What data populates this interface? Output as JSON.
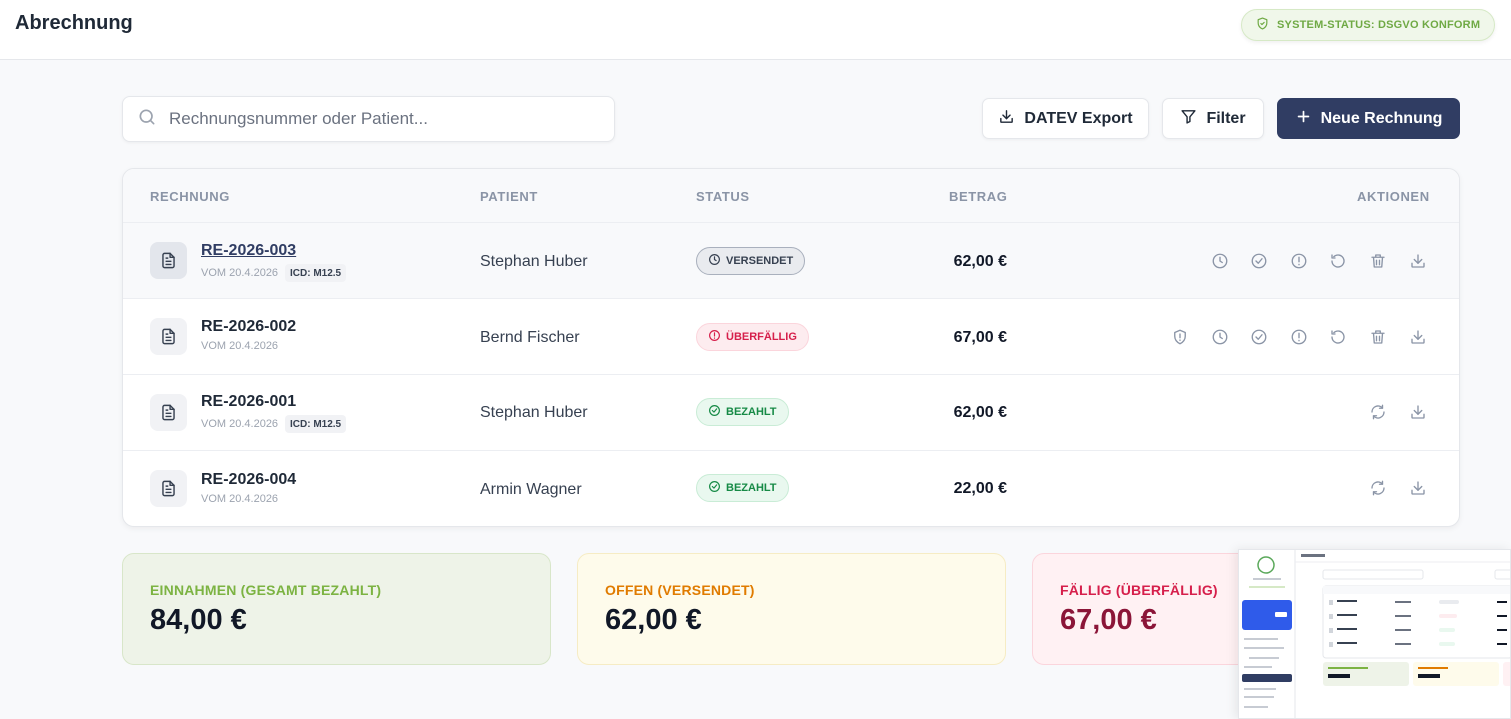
{
  "header": {
    "title": "Abrechnung",
    "system_status": "SYSTEM-STATUS: DSGVO KONFORM"
  },
  "search": {
    "placeholder": "Rechnungsnummer oder Patient..."
  },
  "toolbar": {
    "datev_label": "DATEV Export",
    "filter_label": "Filter",
    "new_label": "Neue Rechnung"
  },
  "table": {
    "columns": [
      "RECHNUNG",
      "PATIENT",
      "STATUS",
      "BETRAG",
      "AKTIONEN"
    ],
    "rows": [
      {
        "number": "RE-2026-003",
        "date": "VOM 20.4.2026",
        "icd": "ICD: M12.5",
        "patient": "Stephan Huber",
        "status": "VERSENDET",
        "amount": "62,00 €"
      },
      {
        "number": "RE-2026-002",
        "date": "VOM 20.4.2026",
        "icd": "",
        "patient": "Bernd Fischer",
        "status": "ÜBERFÄLLIG",
        "amount": "67,00 €"
      },
      {
        "number": "RE-2026-001",
        "date": "VOM 20.4.2026",
        "icd": "ICD: M12.5",
        "patient": "Stephan Huber",
        "status": "BEZAHLT",
        "amount": "62,00 €"
      },
      {
        "number": "RE-2026-004",
        "date": "VOM 20.4.2026",
        "icd": "",
        "patient": "Armin Wagner",
        "status": "BEZAHLT",
        "amount": "22,00 €"
      }
    ]
  },
  "stats": {
    "income": {
      "label": "EINNAHMEN (GESAMT BEZAHLT)",
      "value": "84,00 €"
    },
    "open": {
      "label": "OFFEN (VERSENDET)",
      "value": "62,00 €"
    },
    "due": {
      "label": "FÄLLIG (ÜBERFÄLLIG)",
      "value": "67,00 €"
    }
  },
  "colors": {
    "primary": "#303d63",
    "paid": "#168a46",
    "overdue": "#d61f4b",
    "open_accent": "#e07b00",
    "income_accent": "#7cb342",
    "due_accent": "#8b1538"
  },
  "icons": [
    "search-icon",
    "download-icon",
    "filter-icon",
    "plus-icon",
    "shield-icon",
    "document-icon",
    "clock-icon",
    "check-circle-icon",
    "alert-circle-icon",
    "undo-icon",
    "trash-icon",
    "refresh-icon"
  ]
}
